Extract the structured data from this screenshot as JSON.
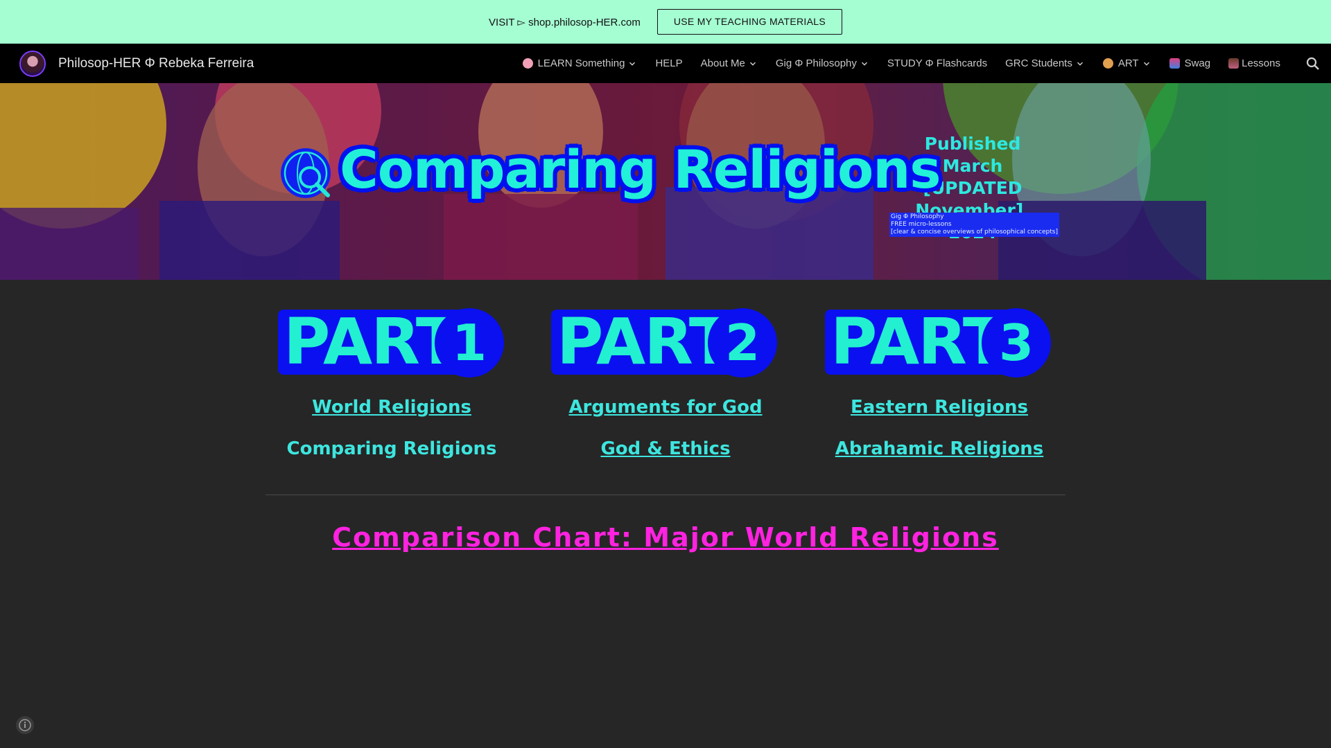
{
  "announcement": {
    "message": "VISIT ▻ shop.philosop-HER.com",
    "button_label": "USE MY TEACHING MATERIALS"
  },
  "nav": {
    "site_title": "Philosop-HER Φ Rebeka Ferreira",
    "items": [
      {
        "label": "LEARN Something",
        "has_dropdown": true,
        "icon": "brain-icon"
      },
      {
        "label": "HELP",
        "has_dropdown": false
      },
      {
        "label": "About Me",
        "has_dropdown": true
      },
      {
        "label": "Gig Φ Philosophy",
        "has_dropdown": true
      },
      {
        "label": "STUDY Φ Flashcards",
        "has_dropdown": false
      },
      {
        "label": "GRC Students",
        "has_dropdown": true
      },
      {
        "label": "ART",
        "has_dropdown": true,
        "icon": "palette-icon"
      },
      {
        "label": "Swag",
        "has_dropdown": false,
        "icon": "shopping-bag-icon"
      },
      {
        "label": "Lessons",
        "has_dropdown": false,
        "icon": "teacher-icon"
      }
    ]
  },
  "banner": {
    "title": "Comparing Religions",
    "published_line1": "Published March",
    "published_line2": "[UPDATED",
    "published_line3": "November], 2024",
    "note_line1": "Gig Φ Philosophy",
    "note_line2": "FREE micro-lessons",
    "note_line3": "[clear & concise overviews of philosophical concepts]"
  },
  "parts": [
    {
      "word": "PART",
      "number": "1",
      "link1": "World Religions",
      "link2": "Comparing Religions"
    },
    {
      "word": "PART",
      "number": "2",
      "link1": "Arguments for God",
      "link2": "God & Ethics"
    },
    {
      "word": "PART",
      "number": "3",
      "link1": "Eastern Religions",
      "link2": "Abrahamic Religions"
    }
  ],
  "chart_heading": "Comparison Chart: Major World Religions",
  "colors": {
    "announcement_bg": "#a5fdd2",
    "nav_bg": "#000000",
    "page_bg": "#262626",
    "accent_cyan": "#3de6df",
    "accent_blue": "#0a10f0",
    "heading_magenta": "#ff22e0"
  }
}
